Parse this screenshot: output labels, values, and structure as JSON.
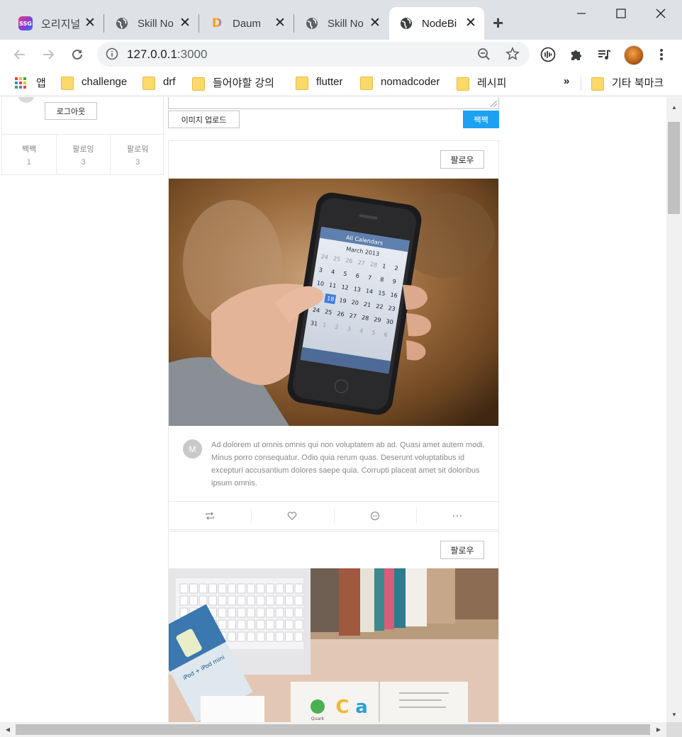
{
  "browser": {
    "tabs": [
      {
        "title": "오리지널",
        "favicon": "ssg-icon",
        "favicon_text": "SSG",
        "active": false
      },
      {
        "title": "Skill No",
        "favicon": "globe-icon",
        "active": false
      },
      {
        "title": "Daum",
        "favicon": "daum-icon",
        "favicon_text": "D",
        "active": false
      },
      {
        "title": "Skill No",
        "favicon": "globe-icon",
        "active": false
      },
      {
        "title": "NodeBi",
        "favicon": "globe-icon",
        "active": true
      }
    ],
    "url_host": "127.0.0.1",
    "url_port": ":3000",
    "bookmarks": {
      "apps_label": "앱",
      "items": [
        "challenge",
        "drf",
        "들어야할 강의",
        "flutter",
        "nomadcoder",
        "레시피"
      ],
      "overflow_label": "»",
      "other_label": "기타 북마크"
    }
  },
  "sidebar": {
    "logout_label": "로그아웃",
    "stats": [
      {
        "label": "짹짹",
        "value": "1"
      },
      {
        "label": "팔로잉",
        "value": "3"
      },
      {
        "label": "팔로워",
        "value": "3"
      }
    ]
  },
  "form": {
    "upload_label": "이미지 업로드",
    "submit_label": "짹짹"
  },
  "posts": [
    {
      "follow_label": "팔로우",
      "avatar_letter": "M",
      "content": "Ad dolorem ut omnis omnis qui non voluptatem ab ad. Quasi amet autem modi. Minus porro consequatur. Odio quia rerum quas. Deserunt voluptatibus id excepturi accusantium dolores saepe quia. Corrupti placeat amet sit doloribus ipsum omnis.",
      "image": {
        "subject": "hand holding smartphone showing calendar",
        "calendar_header": "All Calendars",
        "calendar_month": "March 2013",
        "calendar_selected": "18"
      }
    },
    {
      "follow_label": "팔로우",
      "image": {
        "subject": "desk with laptop keyboard, books and magazines",
        "magazine_text": "iPod + iPod mini",
        "logo_text": "Quark"
      }
    }
  ],
  "colors": {
    "accent": "#1da1f2",
    "tabstrip": "#dee1e6",
    "omnibox": "#f1f3f4"
  }
}
